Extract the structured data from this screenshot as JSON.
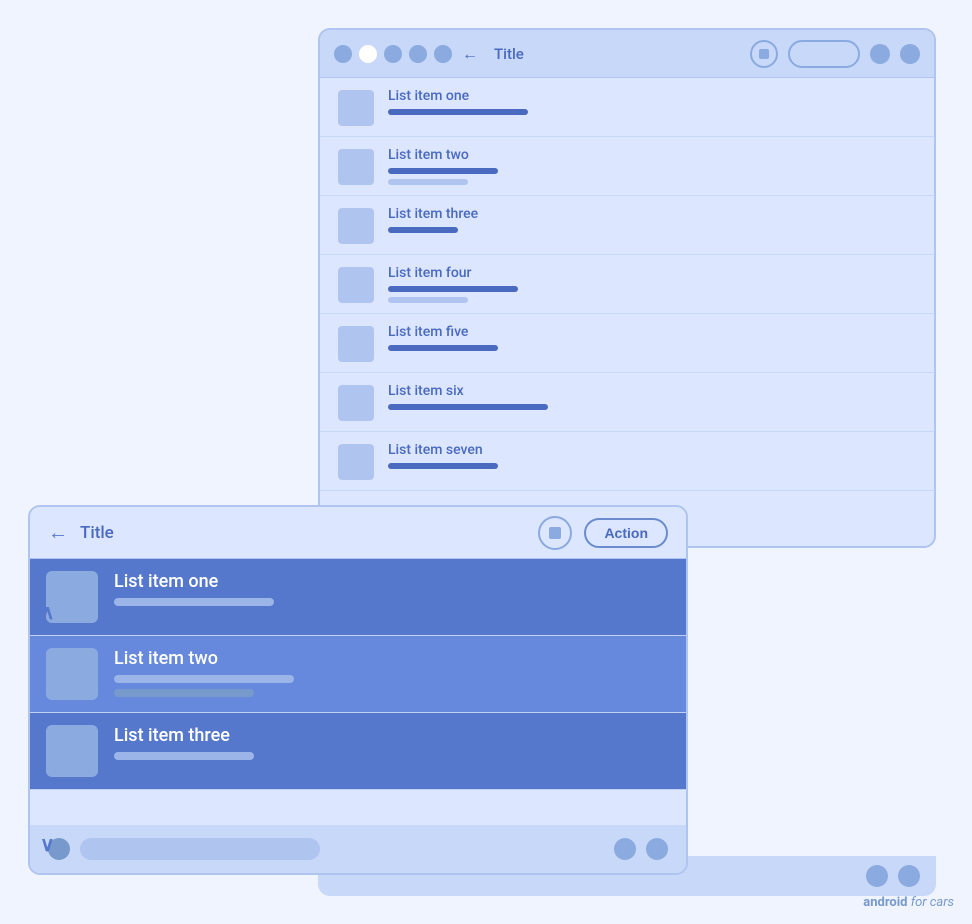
{
  "backWindow": {
    "titleBarDots": [
      "dot",
      "dot-white",
      "dot",
      "dot",
      "dot"
    ],
    "title": "Title",
    "listItems": [
      {
        "label": "List item one",
        "bar1Width": 140,
        "hasSub": false
      },
      {
        "label": "List item two",
        "bar1Width": 110,
        "hasSub": true,
        "bar2Width": 80
      },
      {
        "label": "List item three",
        "bar1Width": 70,
        "hasSub": false
      },
      {
        "label": "List item four",
        "bar1Width": 130,
        "hasSub": true,
        "bar2Width": 80
      },
      {
        "label": "List item five",
        "bar1Width": 110,
        "hasSub": false
      },
      {
        "label": "List item six",
        "bar1Width": 160,
        "hasSub": false
      },
      {
        "label": "List item seven",
        "bar1Width": 110,
        "hasSub": false
      }
    ]
  },
  "frontWindow": {
    "title": "Title",
    "actionLabel": "Action",
    "listItems": [
      {
        "label": "List item one",
        "bar1Width": 160,
        "hasSub": false
      },
      {
        "label": "List item two",
        "bar1Width": 180,
        "hasSub": true,
        "bar2Width": 140
      },
      {
        "label": "List item three",
        "bar1Width": 140,
        "hasSub": false
      }
    ]
  },
  "watermark": {
    "prefix": "android",
    "suffix": "for cars"
  }
}
